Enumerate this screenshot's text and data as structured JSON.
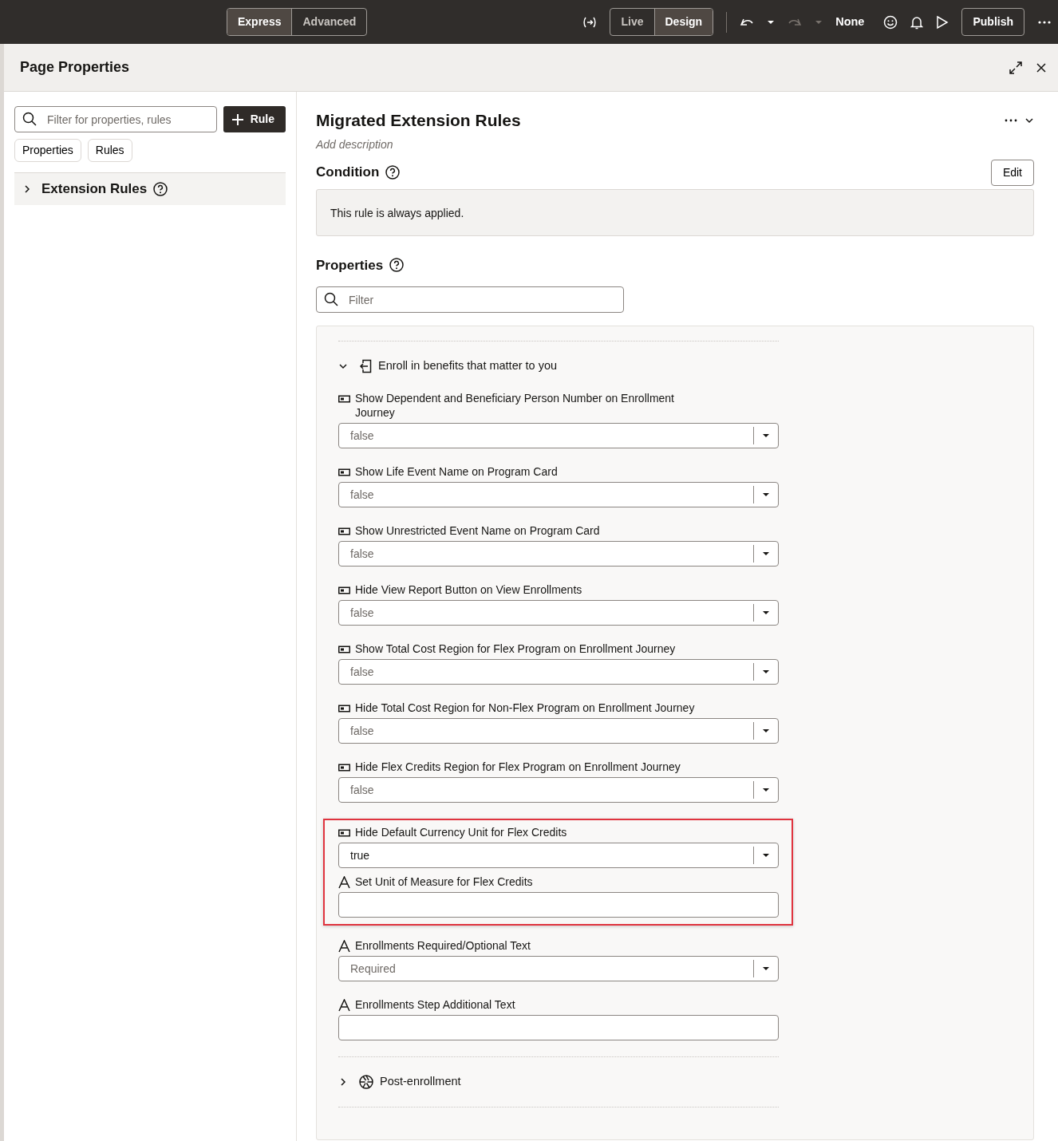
{
  "toolbar": {
    "modes": [
      {
        "label": "Express",
        "selected": true
      },
      {
        "label": "Advanced",
        "selected": false
      }
    ],
    "views": [
      {
        "label": "Live",
        "selected": false
      },
      {
        "label": "Design",
        "selected": true
      }
    ],
    "undo_disabled": false,
    "redo_disabled": true,
    "sandbox": "None",
    "publish": "Publish"
  },
  "panel": {
    "title": "Page Properties"
  },
  "sidebar": {
    "search": {
      "placeholder": "Filter for properties, rules"
    },
    "add_button": "Rule",
    "chips": [
      "Properties",
      "Rules"
    ],
    "tree": [
      {
        "label": "Extension Rules",
        "expanded": false
      }
    ]
  },
  "rule": {
    "title": "Migrated Extension Rules",
    "description_placeholder": "Add description",
    "condition": {
      "heading": "Condition",
      "edit": "Edit",
      "text": "This rule is always applied."
    },
    "properties": {
      "heading": "Properties",
      "filter": {
        "placeholder": "Filter"
      },
      "groups": [
        {
          "title": "Enroll in benefits that matter to you",
          "expanded": true,
          "items": [
            {
              "kind": "toggle",
              "label": "Show Dependent and Beneficiary Person Number on Enrollment Journey",
              "value": "false",
              "default": true,
              "highlighted": false
            },
            {
              "kind": "toggle",
              "label": "Show Life Event Name on Program Card",
              "value": "false",
              "default": true,
              "highlighted": false
            },
            {
              "kind": "toggle",
              "label": "Show Unrestricted Event Name on Program Card",
              "value": "false",
              "default": true,
              "highlighted": false
            },
            {
              "kind": "toggle",
              "label": "Hide View Report Button on View Enrollments",
              "value": "false",
              "default": true,
              "highlighted": false
            },
            {
              "kind": "toggle",
              "label": "Show Total Cost Region for Flex Program on Enrollment Journey",
              "value": "false",
              "default": true,
              "highlighted": false
            },
            {
              "kind": "toggle",
              "label": "Hide Total Cost Region for Non-Flex Program on Enrollment Journey",
              "value": "false",
              "default": true,
              "highlighted": false
            },
            {
              "kind": "toggle",
              "label": "Hide Flex Credits Region for Flex Program on Enrollment Journey",
              "value": "false",
              "default": true,
              "highlighted": false
            },
            {
              "kind": "toggle",
              "label": "Hide Default Currency Unit for Flex Credits",
              "value": "true",
              "default": false,
              "highlighted": true
            },
            {
              "kind": "text",
              "label": "Set Unit of Measure for Flex Credits",
              "highlighted": true
            },
            {
              "kind": "choice",
              "label": "Enrollments Required/Optional Text",
              "value": "Required",
              "default": true,
              "highlighted": false
            },
            {
              "kind": "text",
              "label": "Enrollments Step Additional Text",
              "highlighted": false
            }
          ]
        },
        {
          "title": "Post-enrollment",
          "expanded": false
        }
      ]
    }
  }
}
